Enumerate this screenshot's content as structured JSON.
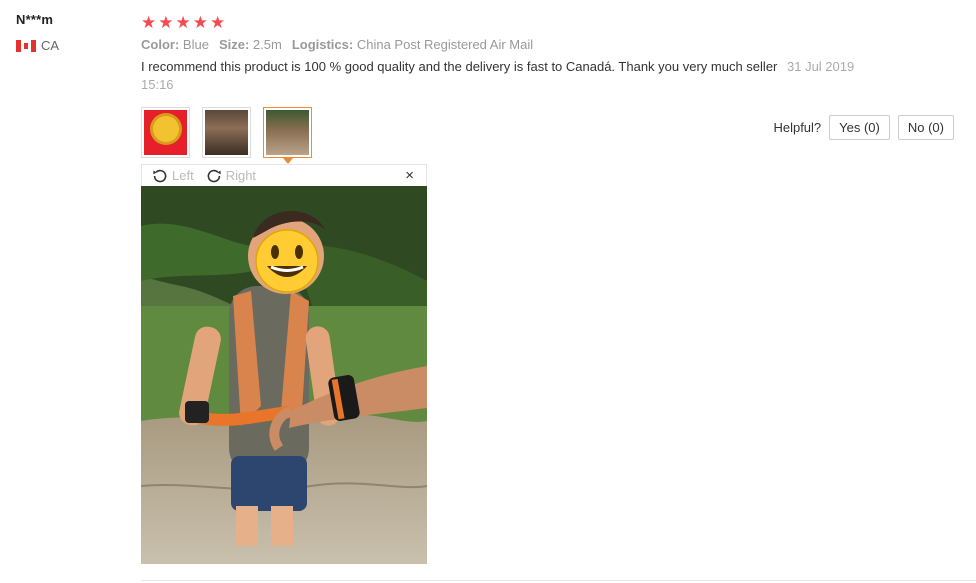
{
  "user": {
    "name": "N***m",
    "country_code": "CA"
  },
  "rating": {
    "stars": 5,
    "max": 5,
    "star_color": "#f44b53"
  },
  "sku": {
    "color_label": "Color:",
    "color_value": "Blue",
    "size_label": "Size:",
    "size_value": "2.5m",
    "logistics_label": "Logistics:",
    "logistics_value": "China Post Registered Air Mail"
  },
  "review": {
    "text": "I recommend this product is 100 % good quality and the delivery is fast to Canadá. Thank you very much seller",
    "date": "31 Jul 2019 15:16"
  },
  "thumbnails": [
    {
      "name": "award-badge-photo",
      "active": false
    },
    {
      "name": "harness-product-photo",
      "active": false
    },
    {
      "name": "child-wearing-harness-photo",
      "active": true
    }
  ],
  "helpful": {
    "label": "Helpful?",
    "yes_label": "Yes (0)",
    "no_label": "No (0)"
  },
  "viewer": {
    "rotate_left_label": "Left",
    "rotate_right_label": "Right",
    "close_label": "×"
  },
  "colors": {
    "accent_orange": "#f08a34",
    "text_muted": "#999999"
  }
}
